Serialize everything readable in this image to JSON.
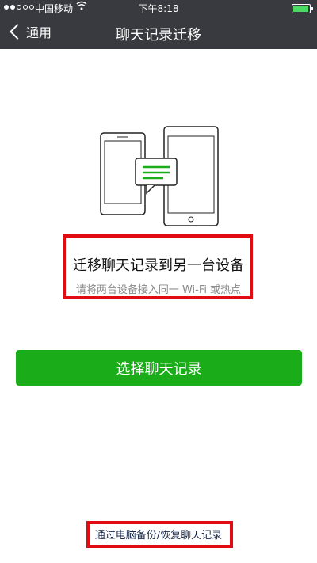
{
  "status_bar": {
    "carrier": "中国移动",
    "time": "下午8:18",
    "wifi_icon": "wifi-icon",
    "battery_level": 0.95
  },
  "navbar": {
    "back_label": "通用",
    "title": "聊天记录迁移"
  },
  "content": {
    "headline": "迁移聊天记录到另一台设备",
    "subline": "请将两台设备接入同一 Wi-Fi 或热点",
    "primary_button": "选择聊天记录",
    "footer_link": "通过电脑备份/恢复聊天记录"
  },
  "colors": {
    "nav_bg": "#393a3f",
    "primary_green": "#1aad19",
    "highlight_red": "#e10b12"
  },
  "icons": {
    "illustration": "two-devices-chat-transfer-illustration"
  }
}
